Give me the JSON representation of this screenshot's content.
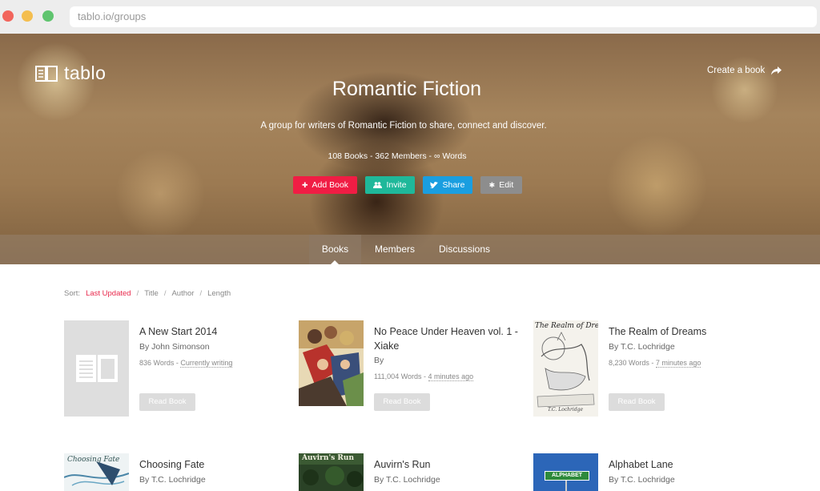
{
  "browser": {
    "url": "tablo.io/groups"
  },
  "header": {
    "logo_text": "tablo",
    "create_link": "Create a book",
    "title": "Romantic Fiction",
    "description": "A group for writers of Romantic Fiction to share, connect and discover.",
    "stats": "108 Books - 362 Members - ∞ Words"
  },
  "actions": {
    "add_book": "Add Book",
    "invite": "Invite",
    "share": "Share",
    "edit": "Edit"
  },
  "tabs": [
    "Books",
    "Members",
    "Discussions"
  ],
  "active_tab": "Books",
  "sort": {
    "label": "Sort:",
    "options": [
      "Last Updated",
      "Title",
      "Author",
      "Length"
    ],
    "active": "Last Updated",
    "separator": "/"
  },
  "books": [
    {
      "title": "A New Start 2014",
      "author": "By John Simonson",
      "words": "836 Words - ",
      "time": "Currently writing",
      "read_label": "Read Book"
    },
    {
      "title": "No Peace Under Heaven vol. 1 - Xiake",
      "author": "By",
      "words": "111,004 Words - ",
      "time": "4 minutes ago",
      "read_label": "Read Book"
    },
    {
      "title": "The Realm of Dreams",
      "author": "By T.C. Lochridge",
      "words": "8,230 Words - ",
      "time": "7 minutes ago",
      "read_label": "Read Book"
    },
    {
      "title": "Choosing Fate",
      "author": "By T.C. Lochridge"
    },
    {
      "title": "Auvirn's Run",
      "author": "By T.C. Lochridge"
    },
    {
      "title": "Alphabet Lane",
      "author": "By T.C. Lochridge"
    }
  ],
  "cover_texts": {
    "realm": "The Realm of Dreams",
    "realm_author": "T.C. Lochridge",
    "choosing": "Choosing Fate",
    "auvirn": "Auvirn's Run",
    "alphabet": "ALPHABET"
  },
  "colors": {
    "add_book": "#f01d44",
    "invite": "#1fb89a",
    "share": "#1a9ee0",
    "edit": "#8d8d8d",
    "accent": "#e8294c"
  }
}
